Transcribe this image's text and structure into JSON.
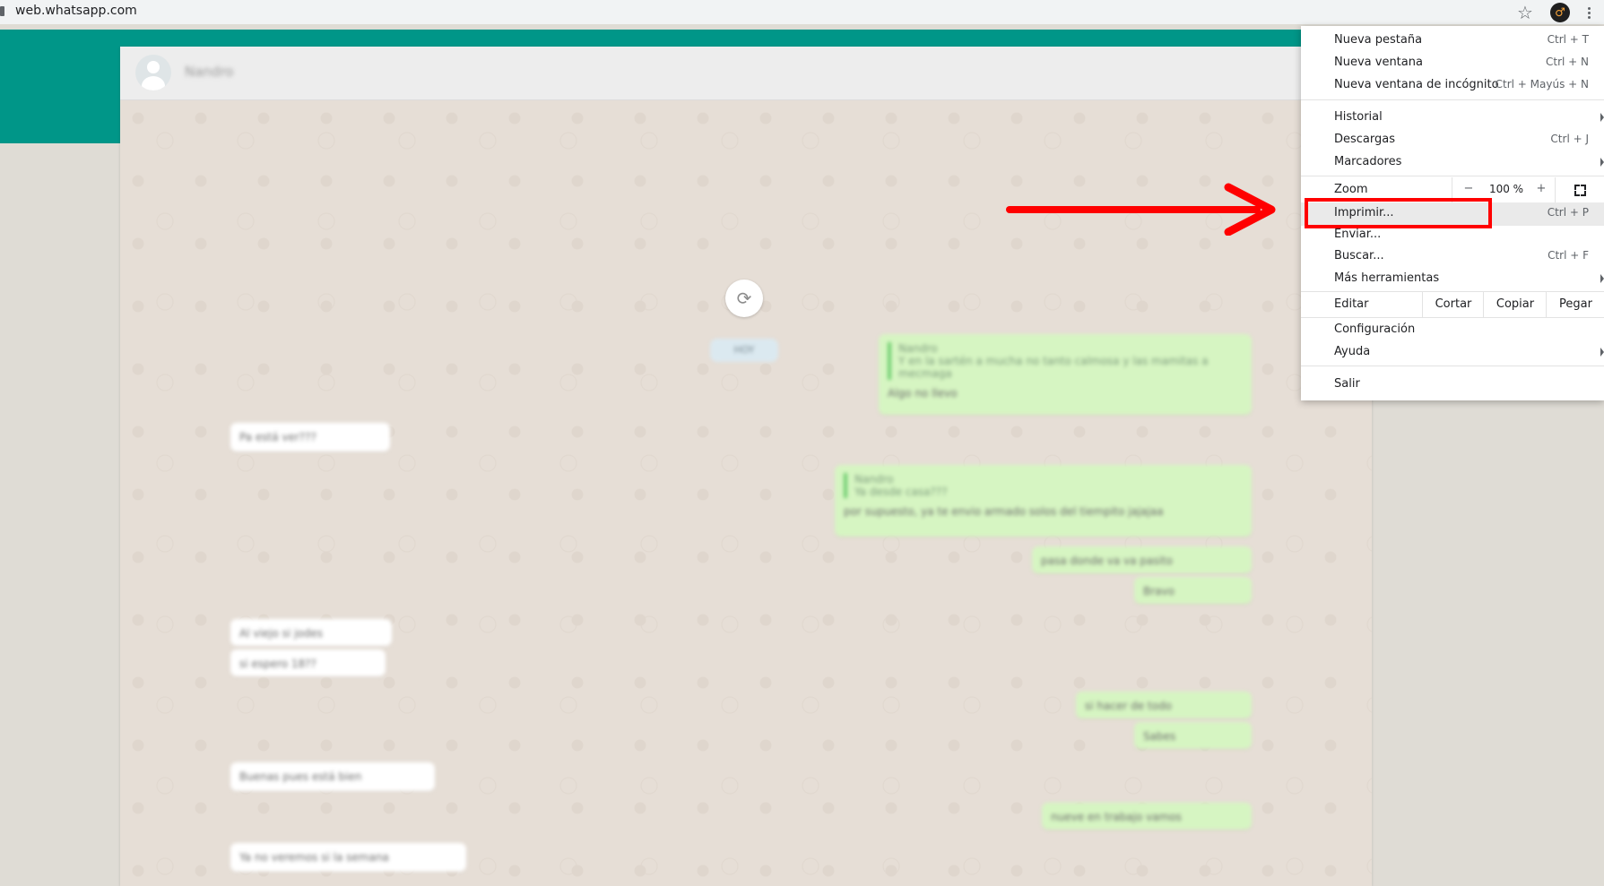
{
  "browser": {
    "url": "web.whatsapp.com",
    "icons": [
      "lock-icon",
      "star-icon",
      "extension-icon",
      "kebab-menu-icon"
    ]
  },
  "chat": {
    "contact_name": "Nandro",
    "date_pill": "HOY",
    "reload_icon": "reload-icon",
    "messages": [
      {
        "dir": "out",
        "quote": "Nandro",
        "quote_text": "Y en la sartén a mucha no tanto calmosa y las mamitas a mecmaga",
        "text": "Algo no llevo"
      },
      {
        "dir": "in",
        "text": "Pa está ver???"
      },
      {
        "dir": "out",
        "quote": "Nandro",
        "quote_text": "Ya desde casa???",
        "text": "por supuesto, ya te envio armado solos del tiempito jajajaa"
      },
      {
        "dir": "out",
        "text": "pasa donde va va pasito"
      },
      {
        "dir": "out",
        "text": "Bravo"
      },
      {
        "dir": "in",
        "text": "Al viejo si jodes"
      },
      {
        "dir": "in",
        "text": "si espero 18??"
      },
      {
        "dir": "out",
        "text": "si hacer de todo"
      },
      {
        "dir": "out",
        "text": "Sabes"
      },
      {
        "dir": "in",
        "text": "Buenas pues está bien"
      },
      {
        "dir": "out",
        "text": "nueve en trabajo vamos"
      },
      {
        "dir": "in",
        "text": "Ya no veremos si la semana"
      }
    ]
  },
  "menu": {
    "items": [
      {
        "label": "Nueva pestaña",
        "shortcut": "Ctrl + T"
      },
      {
        "label": "Nueva ventana",
        "shortcut": "Ctrl + N"
      },
      {
        "label": "Nueva ventana de incógnito",
        "shortcut": "Ctrl + Mayús + N"
      },
      {
        "label": "Historial",
        "shortcut": ""
      },
      {
        "label": "Descargas",
        "shortcut": "Ctrl + J"
      },
      {
        "label": "Marcadores",
        "shortcut": ""
      },
      {
        "label": "Imprimir...",
        "shortcut": "Ctrl + P"
      },
      {
        "label": "Enviar...",
        "shortcut": ""
      },
      {
        "label": "Buscar...",
        "shortcut": "Ctrl + F"
      },
      {
        "label": "Más herramientas",
        "shortcut": ""
      },
      {
        "label": "Configuración",
        "shortcut": ""
      },
      {
        "label": "Ayuda",
        "shortcut": ""
      },
      {
        "label": "Salir",
        "shortcut": ""
      }
    ],
    "zoom": {
      "label": "Zoom",
      "minus": "−",
      "value": "100 %",
      "plus": "+"
    },
    "edit": {
      "label": "Editar",
      "cut": "Cortar",
      "copy": "Copiar",
      "paste": "Pegar"
    }
  },
  "annotation": {
    "highlight_color": "#ff0000",
    "arrow_color": "#ff0000",
    "highlighted_item": "Imprimir..."
  }
}
